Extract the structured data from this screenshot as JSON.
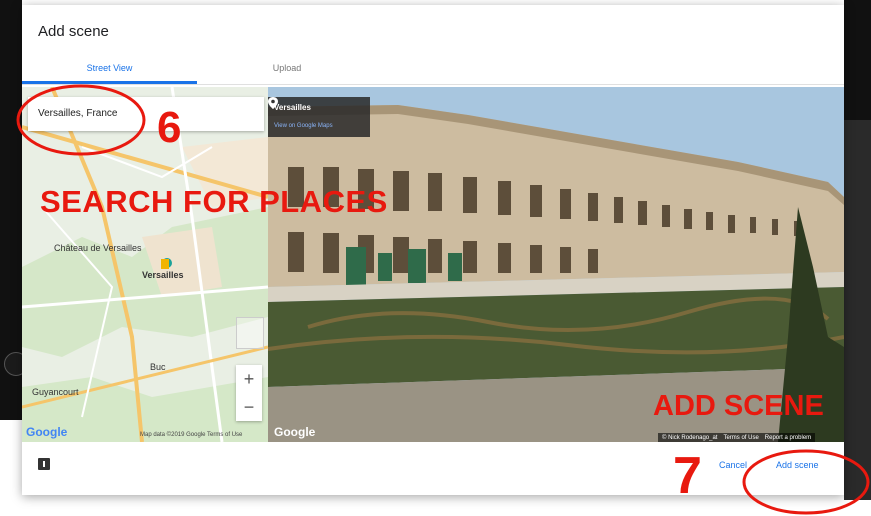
{
  "dialog": {
    "title": "Add scene",
    "tabs": [
      {
        "label": "Street View",
        "active": true
      },
      {
        "label": "Upload",
        "active": false
      }
    ]
  },
  "map": {
    "search_value": "Versailles, France",
    "labels": {
      "chateau": "Château de Versailles",
      "city": "Versailles",
      "buc": "Buc",
      "guyancourt": "Guyancourt"
    },
    "zoom_in": "+",
    "zoom_out": "−",
    "logo": "Google",
    "footer": "Map data ©2019 Google   Terms of Use"
  },
  "street_view": {
    "place_title": "Versailles",
    "place_link": "View on Google Maps",
    "logo": "Google",
    "footer": [
      "© Nick Rodenago_at",
      "Terms of Use",
      "Report a problem"
    ]
  },
  "footer": {
    "cancel": "Cancel",
    "add_scene": "Add scene"
  },
  "annotations": {
    "step_6": "6",
    "search_for_places": "SEARCH FOR PLACES",
    "add_scene": "ADD SCENE",
    "step_7": "7"
  },
  "colors": {
    "accent": "#1a73e8",
    "annotation": "#e8190f"
  },
  "icons": [
    "location-pin-icon",
    "feedback-icon",
    "pegman-icon"
  ]
}
